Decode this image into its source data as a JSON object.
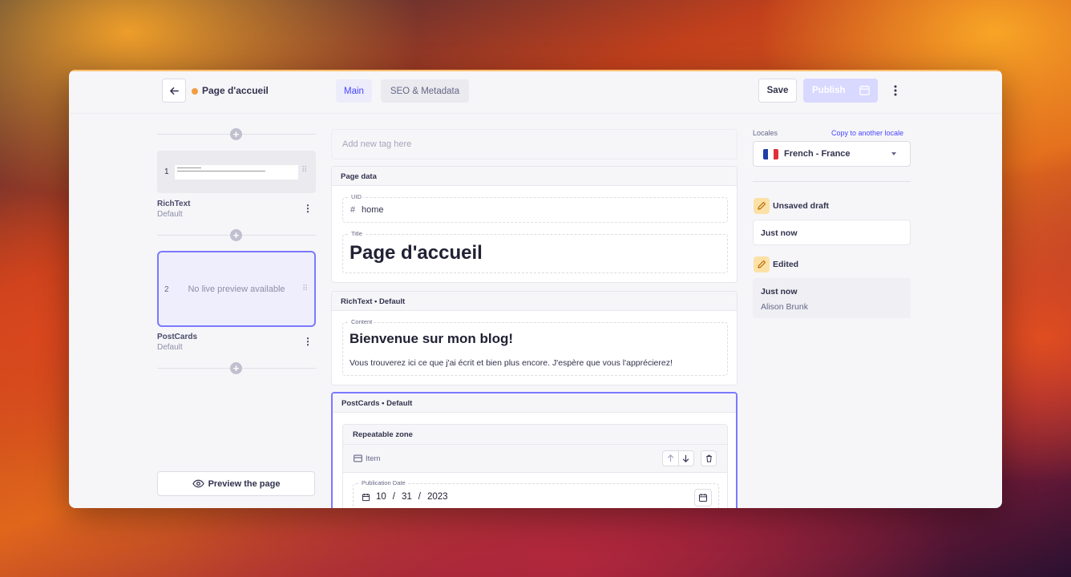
{
  "header": {
    "page_name": "Page d'accueil",
    "tabs": [
      "Main",
      "SEO & Metadata"
    ],
    "save_label": "Save",
    "publish_label": "Publish"
  },
  "left": {
    "blocks": [
      {
        "index": "1",
        "title": "RichText",
        "sub": "Default"
      },
      {
        "index": "2",
        "title": "PostCards",
        "sub": "Default",
        "message": "No live preview available"
      }
    ],
    "preview_label": "Preview the page"
  },
  "main": {
    "tag_placeholder": "Add new tag here",
    "page_data": {
      "heading": "Page data",
      "uid_label": "UID",
      "uid_value": "home",
      "title_label": "Title",
      "title_value": "Page d'accueil"
    },
    "richtext": {
      "heading": "RichText • Default",
      "content_label": "Content",
      "content_heading": "Bienvenue sur mon blog!",
      "content_text": "Vous trouverez ici ce que j'ai écrit et bien plus encore. J'espère que vous l'apprécierez!"
    },
    "postcards": {
      "heading": "PostCards • Default",
      "zone_label": "Repeatable zone",
      "item_label": "Item",
      "date_label": "Publication Date",
      "date_month": "10",
      "date_day": "31",
      "date_year": "2023",
      "date_sep": "/"
    }
  },
  "right": {
    "locales_label": "Locales",
    "copy_link": "Copy to another locale",
    "locale_value": "French - France",
    "unsaved_label": "Unsaved draft",
    "unsaved_time": "Just now",
    "edited_label": "Edited",
    "edited_time": "Just now",
    "edited_by": "Alison Brunk"
  },
  "colors": {
    "accent": "#4945ff",
    "status_dot": "#f29d41",
    "flag_blue": "#1f3fa6",
    "flag_white": "#ffffff",
    "flag_red": "#e0313a"
  }
}
